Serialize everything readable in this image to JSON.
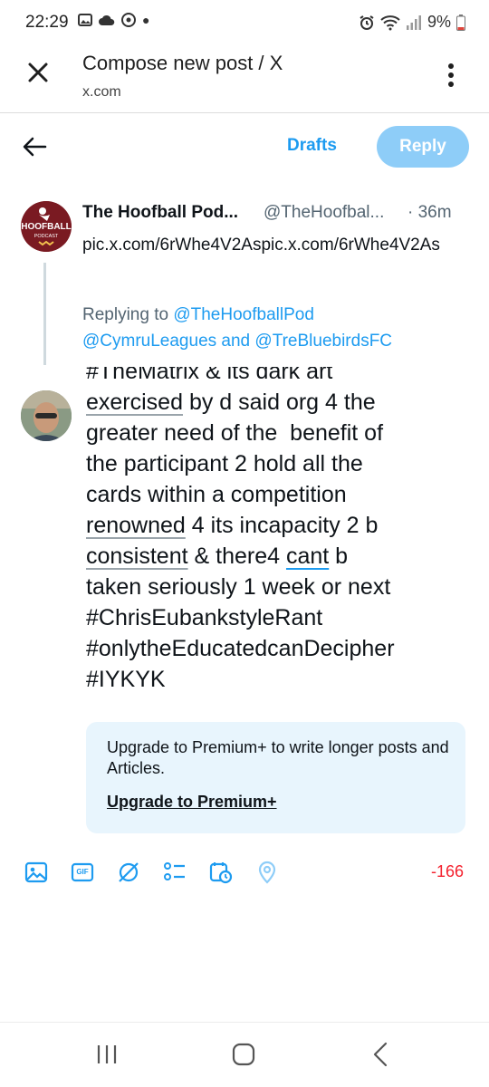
{
  "status_bar": {
    "time": "22:29",
    "battery": "9%"
  },
  "browser": {
    "title": "Compose new post / X",
    "url": "x.com"
  },
  "header": {
    "drafts_label": "Drafts",
    "reply_label": "Reply"
  },
  "original_post": {
    "name": "The Hoofball Pod...",
    "handle": "@TheHoofbal...",
    "time": "· 36m",
    "body": "pic.x.com/6rWhe4V2Aspic.x.com/6rWhe4V2As",
    "avatar_text": "THE HOOFBALL PODCAST"
  },
  "replying": {
    "prefix": "Replying to",
    "to1": "@TheHoofballPod",
    "to2": "@CymruLeagues",
    "and": "and",
    "to3": "@TreBluebirdsFC"
  },
  "compose": {
    "line0": "#TheMatrix & its dark art",
    "w_exercised": "exercised",
    "t_after_exercised": " by d said org 4 the",
    "line2": "greater need of the  benefit of",
    "line3": "the participant 2 hold all the",
    "line4": "cards within a competition",
    "w_renowned": "renowned",
    "t_after_renowned": " 4 its incapacity 2 b",
    "w_consistent": "consistent",
    "t_mid": " & there4 ",
    "w_cant": "cant",
    "t_end": " b",
    "line7": "taken seriously 1 week or next",
    "line8": "#ChrisEubankstyleRant",
    "line9": "#onlytheEducatedcanDecipher",
    "line10": "#IYKYK"
  },
  "premium": {
    "text": "Upgrade to Premium+ to write longer posts and Articles.",
    "link": "Upgrade to Premium+"
  },
  "toolbar": {
    "char_count": "-166",
    "gif_label": "GIF",
    "icons": [
      "image-icon",
      "gif-icon",
      "grok-icon",
      "poll-icon",
      "schedule-icon",
      "location-icon"
    ]
  },
  "colors": {
    "accent": "#1d9bf0",
    "reply_disabled": "#8ecdf8",
    "premium_bg": "#e8f5fd",
    "error": "#f4212e"
  }
}
